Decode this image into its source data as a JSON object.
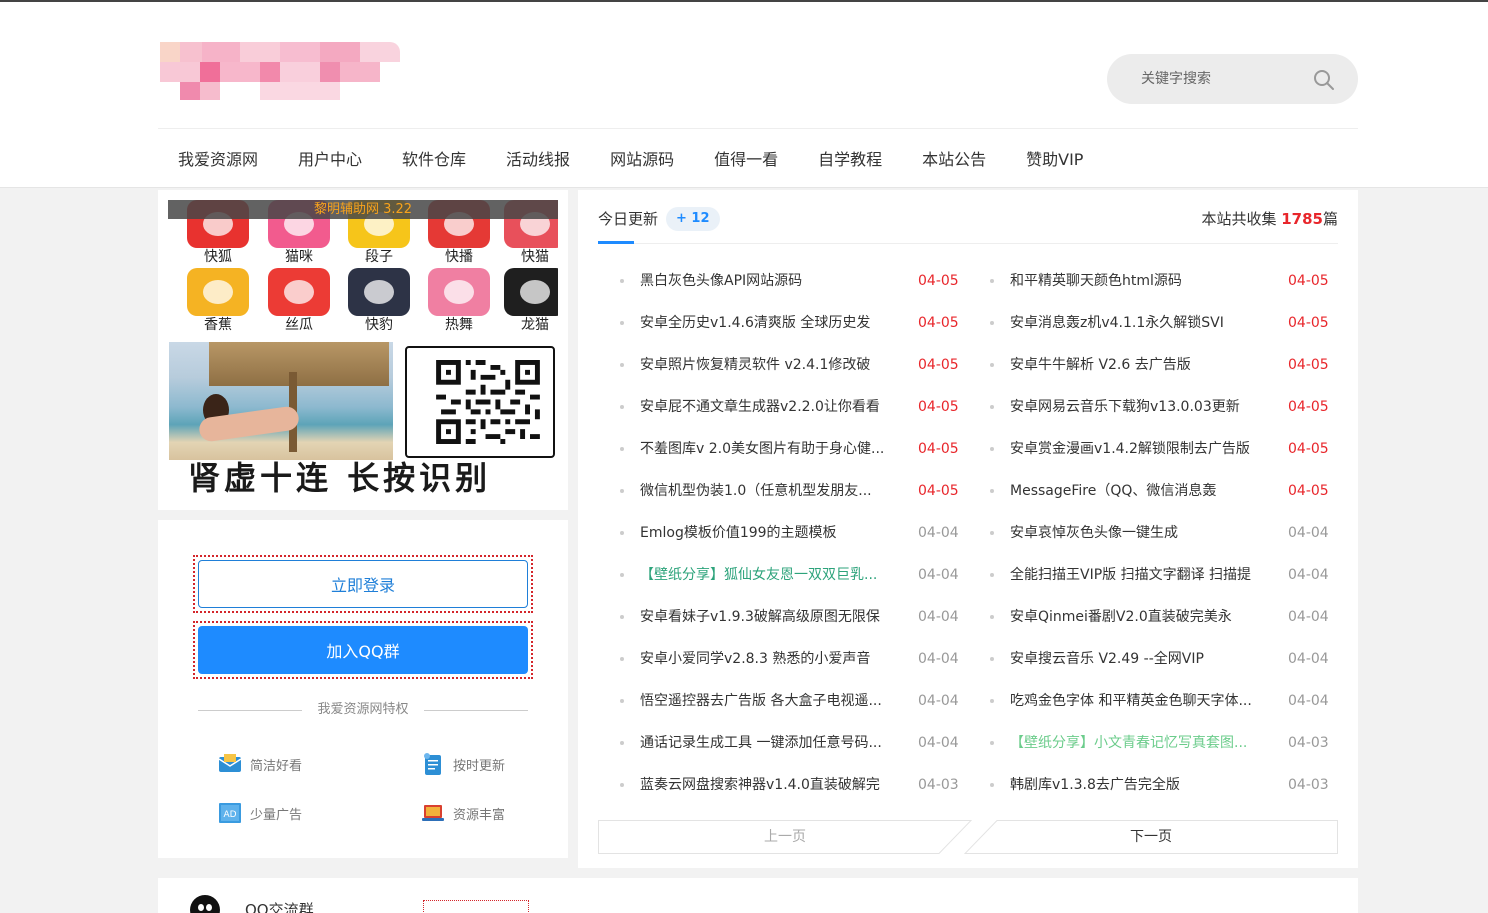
{
  "search": {
    "placeholder": "关键字搜索"
  },
  "nav": [
    "我爱资源网",
    "用户中心",
    "软件仓库",
    "活动线报",
    "网站源码",
    "值得一看",
    "自学教程",
    "本站公告",
    "赞助VIP"
  ],
  "ad": {
    "banner": "黎明辅助网 3.22",
    "apps": [
      {
        "label": "快狐",
        "color": "#e8322f"
      },
      {
        "label": "猫咪",
        "color": "#f25b8e"
      },
      {
        "label": "段子",
        "color": "#f6c51a"
      },
      {
        "label": "快播",
        "color": "#e53935"
      },
      {
        "label": "快猫",
        "color": "#e8505b"
      },
      {
        "label": "香蕉",
        "color": "#f5b323"
      },
      {
        "label": "丝瓜",
        "color": "#ec3b35"
      },
      {
        "label": "快豹",
        "color": "#2d3346"
      },
      {
        "label": "热舞",
        "color": "#f07fa2"
      },
      {
        "label": "龙猫",
        "color": "#1f1f1f"
      }
    ],
    "slogan": "肾虚十连 长按识别"
  },
  "login": {
    "login_button": "立即登录",
    "qq_button": "加入QQ群",
    "privilege_title": "我爱资源网特权",
    "features": [
      {
        "label": "简洁好看",
        "icon": "envelope-icon"
      },
      {
        "label": "按时更新",
        "icon": "document-icon"
      },
      {
        "label": "少量广告",
        "icon": "ad-icon"
      },
      {
        "label": "资源丰富",
        "icon": "laptop-icon"
      }
    ]
  },
  "updates": {
    "tab_label": "今日更新",
    "today_count": "+ 12",
    "total_prefix": "本站共收集 ",
    "total_count": "1785",
    "total_suffix": "篇",
    "left": [
      {
        "title": "黑白灰色头像API网站源码",
        "date": "04-05",
        "hot": true,
        "style": ""
      },
      {
        "title": "安卓全历史v1.4.6清爽版 全球历史发",
        "date": "04-05",
        "hot": true,
        "style": ""
      },
      {
        "title": "安卓照片恢复精灵软件 v2.4.1修改破",
        "date": "04-05",
        "hot": true,
        "style": ""
      },
      {
        "title": "安卓屁不通文章生成器v2.2.0让你看看",
        "date": "04-05",
        "hot": true,
        "style": ""
      },
      {
        "title": "不羞图库v 2.0美女图片有助于身心健...",
        "date": "04-05",
        "hot": true,
        "style": ""
      },
      {
        "title": "微信机型伪装1.0（任意机型发朋友...",
        "date": "04-05",
        "hot": true,
        "style": ""
      },
      {
        "title": "Emlog模板价值199的主题模板",
        "date": "04-04",
        "hot": false,
        "style": ""
      },
      {
        "title": "【壁纸分享】狐仙女友恩一双双巨乳...",
        "date": "04-04",
        "hot": false,
        "style": "green"
      },
      {
        "title": "安卓看妹子v1.9.3破解高级原图无限保",
        "date": "04-04",
        "hot": false,
        "style": ""
      },
      {
        "title": "安卓小爱同学v2.8.3 熟悉的小爱声音",
        "date": "04-04",
        "hot": false,
        "style": ""
      },
      {
        "title": "悟空遥控器去广告版 各大盒子电视遥...",
        "date": "04-04",
        "hot": false,
        "style": ""
      },
      {
        "title": "通话记录生成工具 一键添加任意号码...",
        "date": "04-04",
        "hot": false,
        "style": ""
      },
      {
        "title": "蓝奏云网盘搜索神器v1.4.0直装破解完",
        "date": "04-03",
        "hot": false,
        "style": ""
      }
    ],
    "right": [
      {
        "title": "和平精英聊天颜色html源码",
        "date": "04-05",
        "hot": true,
        "style": ""
      },
      {
        "title": "安卓消息轰z机v4.1.1永久解锁SVI",
        "date": "04-05",
        "hot": true,
        "style": ""
      },
      {
        "title": "安卓牛牛解析 V2.6 去广告版",
        "date": "04-05",
        "hot": true,
        "style": ""
      },
      {
        "title": "安卓网易云音乐下载狗v13.0.03更新",
        "date": "04-05",
        "hot": true,
        "style": ""
      },
      {
        "title": "安卓赏金漫画v1.4.2解锁限制去广告版",
        "date": "04-05",
        "hot": true,
        "style": ""
      },
      {
        "title": "MessageFire（QQ、微信消息轰",
        "date": "04-05",
        "hot": true,
        "style": ""
      },
      {
        "title": "安卓哀悼灰色头像一键生成",
        "date": "04-04",
        "hot": false,
        "style": ""
      },
      {
        "title": "全能扫描王VIP版 扫描文字翻译 扫描提",
        "date": "04-04",
        "hot": false,
        "style": ""
      },
      {
        "title": "安卓Qinmei番剧V2.0直装破完美永",
        "date": "04-04",
        "hot": false,
        "style": ""
      },
      {
        "title": "安卓搜云音乐 V2.49 --全网VIP",
        "date": "04-04",
        "hot": false,
        "style": ""
      },
      {
        "title": "吃鸡金色字体 和平精英金色聊天字体...",
        "date": "04-04",
        "hot": false,
        "style": ""
      },
      {
        "title": "【壁纸分享】小文青春记忆写真套图...",
        "date": "04-03",
        "hot": false,
        "style": "lgreen"
      },
      {
        "title": "韩剧库v1.3.8去广告完全版",
        "date": "04-03",
        "hot": false,
        "style": ""
      }
    ],
    "prev_page": "上一页",
    "next_page": "下一页"
  },
  "qq_group": {
    "title": "QQ交流群"
  },
  "colors": {
    "accent": "#1e8bff",
    "hot_date": "#e8262b",
    "green_title": "#2da37b"
  }
}
